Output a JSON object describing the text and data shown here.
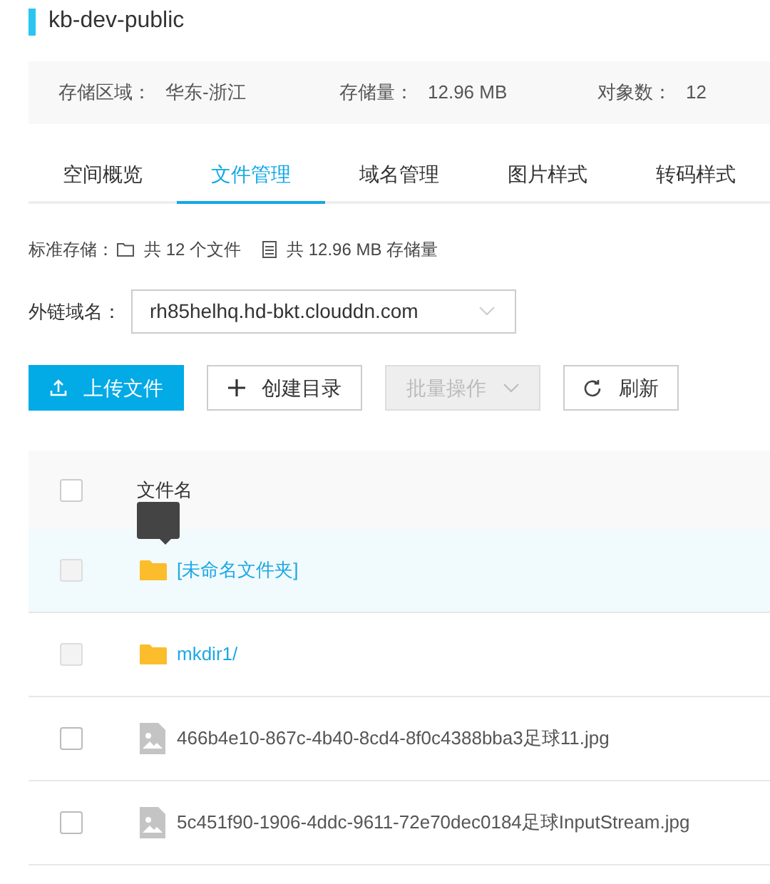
{
  "bucket": {
    "title": "kb-dev-public"
  },
  "info": [
    {
      "label": "存储区域：",
      "value": "华东-浙江"
    },
    {
      "label": "存储量：",
      "value": "12.96 MB"
    },
    {
      "label": "对象数：",
      "value": "12"
    }
  ],
  "tabs": [
    {
      "label": "空间概览",
      "selected": false
    },
    {
      "label": "文件管理",
      "selected": true
    },
    {
      "label": "域名管理",
      "selected": false
    },
    {
      "label": "图片样式",
      "selected": false
    },
    {
      "label": "转码样式",
      "selected": false
    }
  ],
  "stats": {
    "label": "标准存储：",
    "files": "共 12 个文件",
    "size": "共 12.96 MB 存储量"
  },
  "domain": {
    "label": "外链域名：",
    "value": "rh85helhq.hd-bkt.clouddn.com"
  },
  "buttons": [
    {
      "kind": "primary",
      "label": "上传文件",
      "disabled": false
    },
    {
      "kind": "create",
      "label": "创建目录",
      "disabled": false
    },
    {
      "kind": "dropdown",
      "label": "批量操作",
      "disabled": true
    },
    {
      "kind": "refresh",
      "label": "刷新",
      "disabled": false
    }
  ],
  "table": {
    "select_all": {
      "checked": false
    },
    "columns": [
      "文件名"
    ],
    "rows": [
      {
        "kind": "folder",
        "name": "[未命名文件夹]",
        "highlighted": true,
        "checkbox_disabled": true
      },
      {
        "kind": "folder",
        "name": "mkdir1/",
        "highlighted": false,
        "checkbox_disabled": true
      },
      {
        "kind": "image",
        "name": "466b4e10-867c-4b40-8cd4-8f0c4388bba3足球11.jpg",
        "highlighted": false,
        "checkbox_disabled": false
      },
      {
        "kind": "image",
        "name": "5c451f90-1906-4ddc-9611-72e70dec0184足球InputStream.jpg",
        "highlighted": false,
        "checkbox_disabled": false
      }
    ]
  }
}
